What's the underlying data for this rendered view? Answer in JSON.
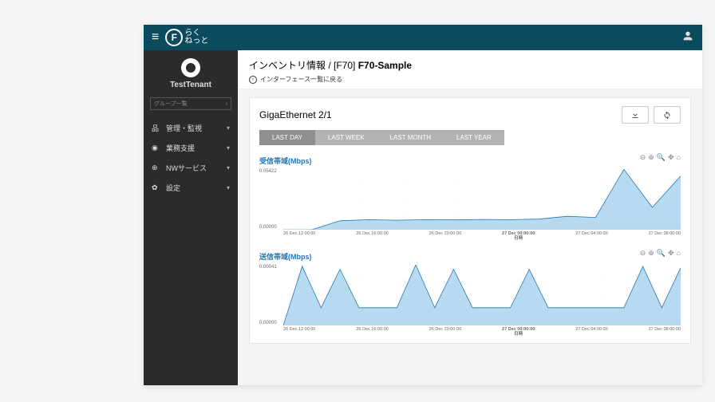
{
  "brand": {
    "mark": "F",
    "line1": "らく",
    "line2": "ねっと"
  },
  "tenant": {
    "name": "TestTenant",
    "group_placeholder": "グループ一覧"
  },
  "sidebar": {
    "items": [
      {
        "icon": "sitemap",
        "label": "管理・監視"
      },
      {
        "icon": "globe",
        "label": "業務支援"
      },
      {
        "icon": "world",
        "label": "NWサービス"
      },
      {
        "icon": "gear",
        "label": "設定"
      }
    ]
  },
  "page": {
    "crumb_prefix": "インベントリ情報 / [F70] ",
    "crumb_bold": "F70-Sample",
    "back_label": "インターフェース一覧に戻る"
  },
  "card": {
    "title": "GigaEthernet 2/1",
    "range_tabs": [
      "LAST DAY",
      "LAST WEEK",
      "LAST MONTH",
      "LAST YEAR"
    ],
    "active_tab": 0
  },
  "charts": [
    {
      "title": "受信帯域(Mbps)",
      "ymax_label": "0.05422",
      "ymin_label": "0.00000"
    },
    {
      "title": "送信帯域(Mbps)",
      "ymax_label": "0.00041",
      "ymin_label": "0.00000"
    }
  ],
  "xaxis_ticks": [
    "26 Dec 12:00:00",
    "26 Dec 16:00:00",
    "26 Dec 20:00:00",
    "27 Dec 00:00:00",
    "27 Dec 04:00:00",
    "27 Dec 08:00:00"
  ],
  "xaxis_label": "日時",
  "chart_data": [
    {
      "type": "area",
      "title": "受信帯域(Mbps)",
      "xlabel": "日時",
      "ylabel": "Mbps",
      "ylim": [
        0,
        0.05422
      ],
      "x": [
        "26 Dec 12:00",
        "26 Dec 14:00",
        "26 Dec 16:00",
        "26 Dec 18:00",
        "26 Dec 20:00",
        "26 Dec 22:00",
        "27 Dec 00:00",
        "27 Dec 02:00",
        "27 Dec 04:00",
        "27 Dec 06:00",
        "27 Dec 07:00",
        "27 Dec 07:30",
        "27 Dec 08:00",
        "27 Dec 08:30",
        "27 Dec 09:00"
      ],
      "values": [
        0,
        0,
        0.008,
        0.009,
        0.0085,
        0.009,
        0.0088,
        0.0092,
        0.009,
        0.0095,
        0.012,
        0.011,
        0.054,
        0.02,
        0.048
      ]
    },
    {
      "type": "area",
      "title": "送信帯域(Mbps)",
      "xlabel": "日時",
      "ylabel": "Mbps",
      "ylim": [
        0,
        0.00041
      ],
      "x": [
        "26 Dec 12:00",
        "26 Dec 13:00",
        "26 Dec 14:00",
        "26 Dec 15:00",
        "26 Dec 16:00",
        "26 Dec 17:00",
        "26 Dec 18:00",
        "26 Dec 19:00",
        "26 Dec 20:00",
        "26 Dec 21:00",
        "26 Dec 22:00",
        "26 Dec 23:00",
        "27 Dec 00:00",
        "27 Dec 01:00",
        "27 Dec 02:00",
        "27 Dec 03:00",
        "27 Dec 04:00",
        "27 Dec 05:00",
        "27 Dec 06:00",
        "27 Dec 07:00",
        "27 Dec 08:00",
        "27 Dec 09:00"
      ],
      "values": [
        0,
        0.0004,
        0.00012,
        0.00038,
        0.00012,
        0.00012,
        0.00012,
        0.00041,
        0.00012,
        0.00038,
        0.00012,
        0.00012,
        0.00012,
        0.00038,
        0.00012,
        0.00012,
        0.00012,
        0.00012,
        0.00012,
        0.0004,
        0.00012,
        0.00039
      ]
    }
  ]
}
